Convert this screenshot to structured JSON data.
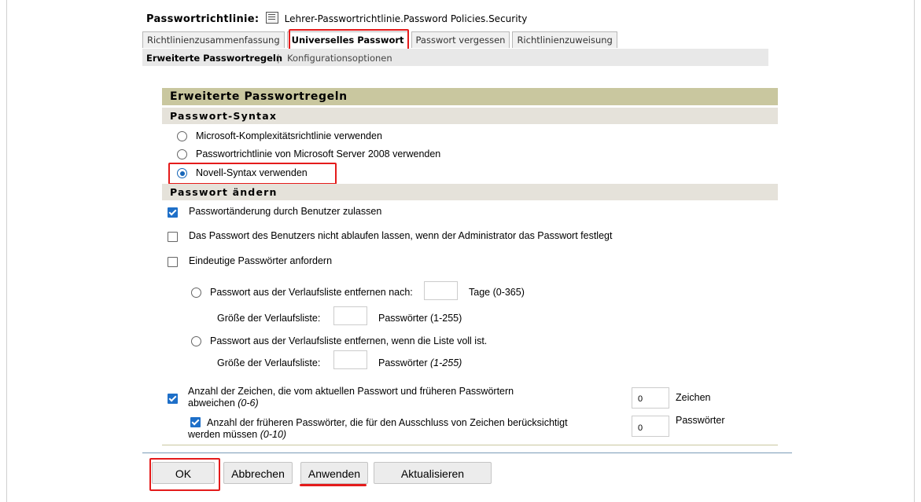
{
  "header": {
    "label": "Passwortrichtlinie:",
    "value": "Lehrer-Passwortrichtlinie.Password Policies.Security"
  },
  "tabs": [
    {
      "label": "Richtlinienzusammenfassung"
    },
    {
      "label": "Universelles Passwort"
    },
    {
      "label": "Passwort vergessen"
    },
    {
      "label": "Richtlinienzuweisung"
    }
  ],
  "subnav": {
    "active": "Erweiterte Passwortregeln",
    "separator": "|",
    "other": "Konfigurationsoptionen"
  },
  "panel": {
    "title": "Erweiterte Passwortregeln",
    "syntax_section": "Passwort-Syntax",
    "syntax_options": [
      {
        "label": "Microsoft-Komplexitätsrichtlinie verwenden",
        "selected": false
      },
      {
        "label": "Passwortrichtlinie von Microsoft Server 2008 verwenden",
        "selected": false
      },
      {
        "label": "Novell-Syntax verwenden",
        "selected": true
      }
    ],
    "change_section": "Passwort ändern",
    "allow_change": {
      "label": "Passwortänderung durch Benutzer zulassen",
      "checked": true
    },
    "no_expire": {
      "label": "Das Passwort des Benutzers nicht ablaufen lassen, wenn der Administrator das Passwort festlegt",
      "checked": false
    },
    "unique": {
      "label": "Eindeutige Passwörter anfordern",
      "checked": false
    },
    "remove_after": {
      "label": "Passwort aus der Verlaufsliste entfernen nach:",
      "value": "",
      "suffix": "Tage (0-365)"
    },
    "history_size_1": {
      "label": "Größe der Verlaufsliste:",
      "value": "",
      "suffix": "Passwörter (1-255)"
    },
    "remove_full": {
      "label": "Passwort aus der Verlaufsliste entfernen, wenn die Liste voll ist."
    },
    "history_size_2": {
      "label": "Größe der Verlaufsliste:",
      "value": "",
      "suffix": "Passwörter",
      "range": "(1-255)"
    },
    "diff_chars": {
      "label_line1": "Anzahl der Zeichen, die vom aktuellen Passwort und früheren Passwörtern",
      "label_line2": "abweichen",
      "range": "(0-6)",
      "value": "0",
      "suffix": "Zeichen",
      "checked": true
    },
    "prev_pw": {
      "label_line1": "Anzahl der früheren Passwörter, die für den Ausschluss von Zeichen berücksichtigt",
      "label_line2": "werden müssen",
      "range": "(0-10)",
      "value": "0",
      "suffix": "Passwörter",
      "checked": true
    }
  },
  "buttons": {
    "ok": "OK",
    "cancel": "Abbrechen",
    "apply": "Anwenden",
    "refresh": "Aktualisieren"
  },
  "colors": {
    "highlight": "#e41b1b",
    "panel_title_bg": "#c9c79f",
    "section_bg": "#e5e2da",
    "check_blue": "#1e6fc8"
  }
}
